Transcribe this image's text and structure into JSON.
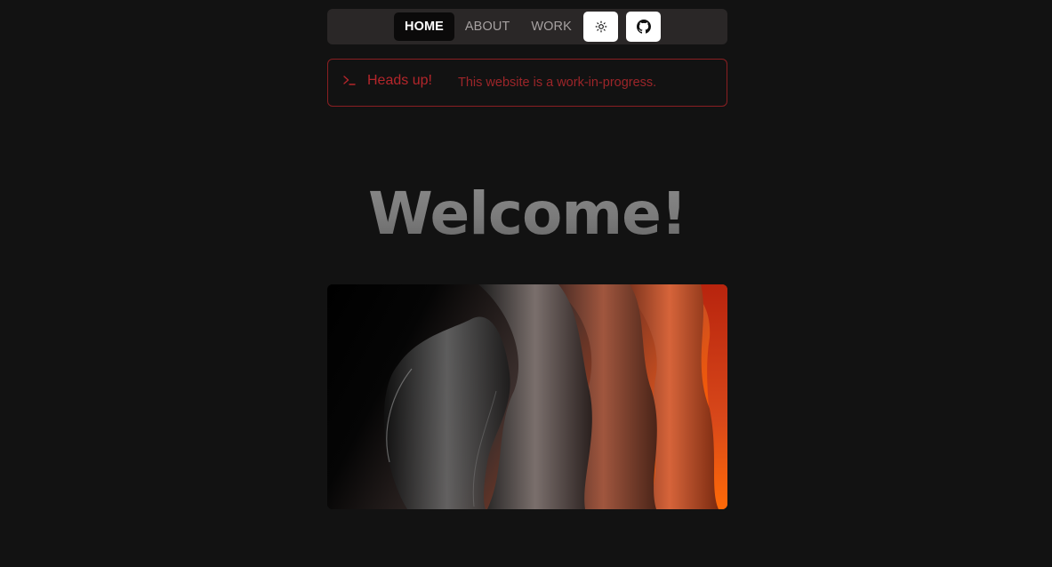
{
  "nav": {
    "links": [
      {
        "label": "HOME",
        "active": true
      },
      {
        "label": "ABOUT",
        "active": false
      },
      {
        "label": "WORK",
        "active": false
      }
    ],
    "theme_toggle_icon": "sun-icon",
    "github_icon": "github-icon"
  },
  "alert": {
    "icon": "terminal-icon",
    "title": "Heads up!",
    "description": "This website is a work-in-progress.",
    "color": "#b4262b"
  },
  "hero": {
    "title": "Welcome!",
    "image": "abstract-wave-image"
  },
  "colors": {
    "background": "#121212",
    "navbar": "#2a2727",
    "alert_border": "#8a1f22"
  }
}
